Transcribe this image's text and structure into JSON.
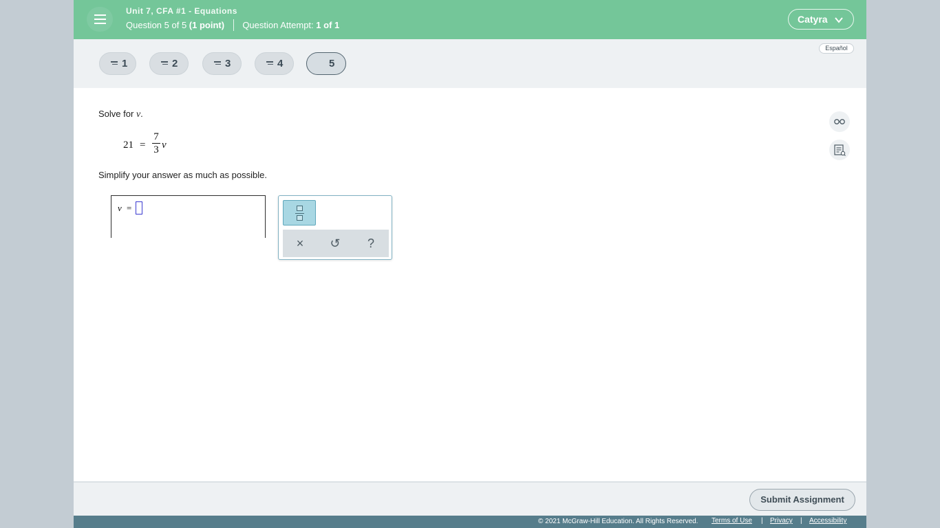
{
  "header": {
    "title": "Unit 7, CFA #1 - Equations",
    "question_label": "Question 5 of 5",
    "points": "(1 point)",
    "attempt_label": "Question Attempt:",
    "attempt_value": "1 of 1",
    "user_name": "Catyra",
    "colors": {
      "header_bg": "#74c699",
      "legal_bg": "#567d8b"
    }
  },
  "question_nav": {
    "items": [
      {
        "label": "1",
        "answered": true
      },
      {
        "label": "2",
        "answered": true
      },
      {
        "label": "3",
        "answered": true
      },
      {
        "label": "4",
        "answered": true
      },
      {
        "label": "5",
        "answered": false,
        "active": true
      }
    ],
    "language_button": "Español"
  },
  "question": {
    "prompt_text": "Solve for",
    "prompt_var": "v",
    "prompt_end": ".",
    "equation": {
      "lhs": "21",
      "equals": "=",
      "numerator": "7",
      "denominator": "3",
      "variable": "v"
    },
    "instruction": "Simplify your answer as much as possible.",
    "answer": {
      "variable": "v",
      "equals": "=",
      "value": ""
    }
  },
  "palette": {
    "tools": [
      {
        "name": "fraction-icon"
      },
      {
        "name": "clear-icon",
        "glyph": "×"
      },
      {
        "name": "undo-icon",
        "glyph": "↺"
      },
      {
        "name": "help-icon",
        "glyph": "?"
      }
    ]
  },
  "side_icons": [
    "reading-glasses-icon",
    "notes-icon"
  ],
  "footer": {
    "submit_label": "Submit Assignment",
    "copyright": "© 2021 McGraw-Hill Education. All Rights Reserved.",
    "links": [
      "Terms of Use",
      "Privacy",
      "Accessibility"
    ],
    "separator": "|"
  }
}
